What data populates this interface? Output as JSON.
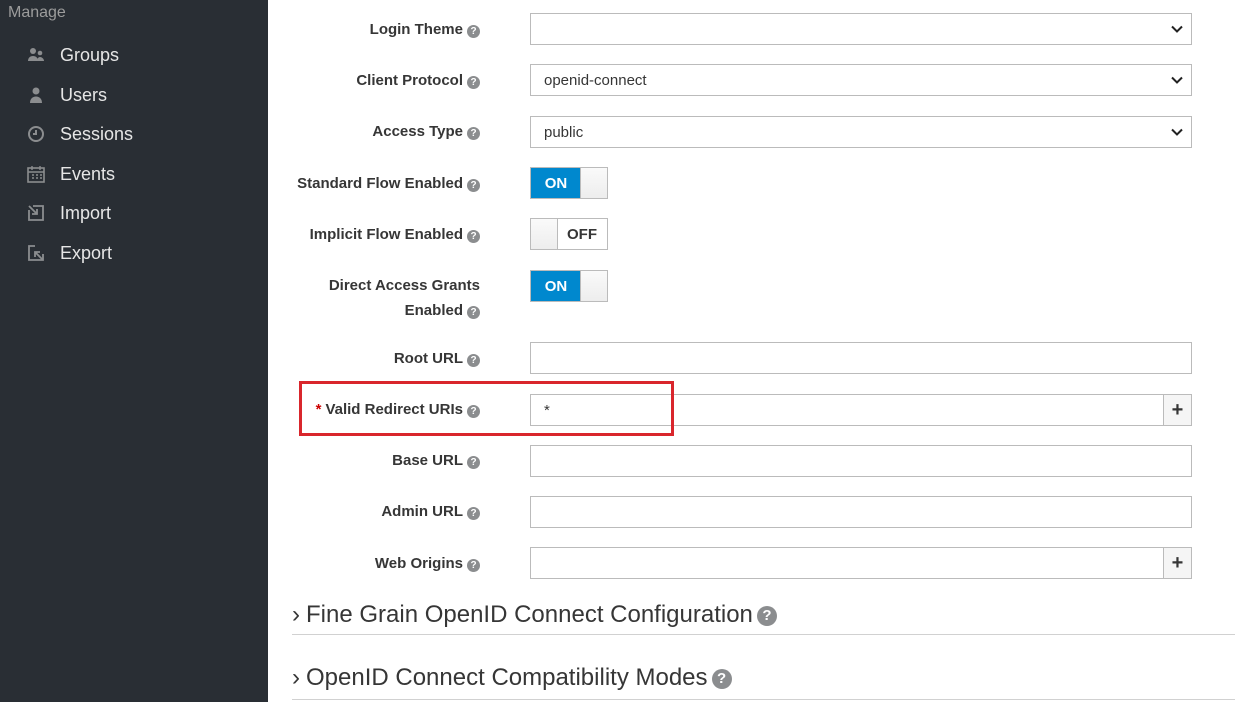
{
  "sidebar": {
    "header": "Manage",
    "items": [
      {
        "label": "Groups",
        "icon": "groups-icon"
      },
      {
        "label": "Users",
        "icon": "user-icon"
      },
      {
        "label": "Sessions",
        "icon": "clock-icon"
      },
      {
        "label": "Events",
        "icon": "calendar-icon"
      },
      {
        "label": "Import",
        "icon": "import-icon"
      },
      {
        "label": "Export",
        "icon": "export-icon"
      }
    ]
  },
  "form": {
    "login_theme": {
      "label": "Login Theme",
      "value": ""
    },
    "client_protocol": {
      "label": "Client Protocol",
      "value": "openid-connect"
    },
    "access_type": {
      "label": "Access Type",
      "value": "public"
    },
    "standard_flow": {
      "label": "Standard Flow Enabled",
      "state": "ON"
    },
    "implicit_flow": {
      "label": "Implicit Flow Enabled",
      "state": "OFF"
    },
    "direct_access": {
      "label_line1": "Direct Access Grants",
      "label_line2": "Enabled",
      "state": "ON"
    },
    "root_url": {
      "label": "Root URL",
      "value": ""
    },
    "valid_redirect": {
      "required_mark": "*",
      "label": "Valid Redirect URIs",
      "value": "*",
      "add": "+"
    },
    "base_url": {
      "label": "Base URL",
      "value": ""
    },
    "admin_url": {
      "label": "Admin URL",
      "value": ""
    },
    "web_origins": {
      "label": "Web Origins",
      "value": "",
      "add": "+"
    }
  },
  "sections": {
    "fine_grain": "Fine Grain OpenID Connect Configuration",
    "compat": "OpenID Connect Compatibility Modes"
  },
  "colors": {
    "sidebar_bg": "#292e34",
    "toggle_on": "#0088ce",
    "highlight": "#d9262c"
  }
}
